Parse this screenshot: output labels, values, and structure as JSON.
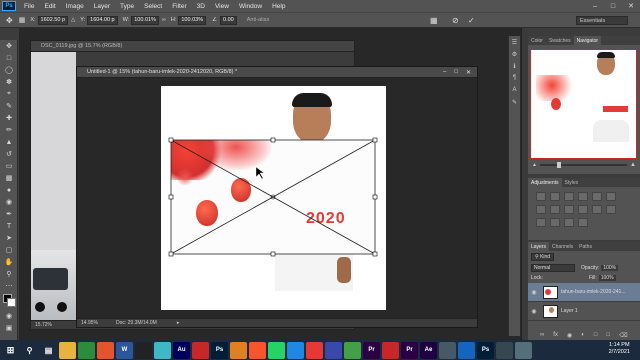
{
  "menubar": {
    "logo": "Ps",
    "items": [
      "File",
      "Edit",
      "Image",
      "Layer",
      "Type",
      "Select",
      "Filter",
      "3D",
      "View",
      "Window",
      "Help"
    ]
  },
  "options": {
    "x_label": "X:",
    "x_value": "1602.50 p",
    "y_label": "Y:",
    "y_value": "1604.00 p",
    "w_label": "W:",
    "w_value": "100.01%",
    "h_label": "H:",
    "h_value": "100.03%",
    "angle_value": "0.00",
    "antialias": "Anti-alias",
    "workspace": "Essentials"
  },
  "doc1": {
    "tab": "DSC_0119.jpg @ 15.7% (RGB/8)",
    "zoom": "15.72%"
  },
  "doc2": {
    "tab": "Untitled-1 @ 15% (tahun-baru-imlek-2020-2412020, RGB/8) *",
    "zoom": "14.95%",
    "doc_size": "Doc: 29.3M/14.0M",
    "banner_text": "2020"
  },
  "top_panel": {
    "tabs": [
      "Color",
      "Swatches",
      "Navigator"
    ],
    "active": "Navigator"
  },
  "adj_panel": {
    "tabs": [
      "Adjustments",
      "Styles"
    ]
  },
  "layers_panel": {
    "tabs": [
      "Layers",
      "Channels",
      "Paths"
    ],
    "kind": "Kind",
    "blend": "Normal",
    "opacity_label": "Opacity:",
    "opacity_value": "100%",
    "lock_label": "Lock:",
    "fill_label": "Fill:",
    "fill_value": "100%",
    "layers": [
      "tahun-baru-imlek-2020-241...",
      "Layer 1"
    ]
  },
  "taskbar": {
    "apps": [
      {
        "name": "start",
        "label": "",
        "color": "#1c2a3e"
      },
      {
        "name": "search",
        "label": "",
        "color": "#1c2a3e"
      },
      {
        "name": "taskview",
        "label": "",
        "color": "#1c2a3e"
      },
      {
        "name": "explorer",
        "label": "",
        "color": "#e8b33c"
      },
      {
        "name": "chrome",
        "label": "",
        "color": "#2d8c3c"
      },
      {
        "name": "firefox",
        "label": "",
        "color": "#e2562b"
      },
      {
        "name": "word",
        "label": "W",
        "color": "#2b579a"
      },
      {
        "name": "media",
        "label": "",
        "color": "#222222"
      },
      {
        "name": "filmora",
        "label": "",
        "color": "#3fb8c6"
      },
      {
        "name": "audition",
        "label": "Au",
        "color": "#00005b"
      },
      {
        "name": "media2",
        "label": "",
        "color": "#c62828"
      },
      {
        "name": "photoshop",
        "label": "Ps",
        "color": "#001e36"
      },
      {
        "name": "app-orange",
        "label": "",
        "color": "#e08020"
      },
      {
        "name": "brave",
        "label": "",
        "color": "#fb542b"
      },
      {
        "name": "whatsapp",
        "label": "",
        "color": "#25d366"
      },
      {
        "name": "app-c",
        "label": "",
        "color": "#1e88e5"
      },
      {
        "name": "app-music",
        "label": "",
        "color": "#e53935"
      },
      {
        "name": "app-s",
        "label": "",
        "color": "#3949ab"
      },
      {
        "name": "app-green",
        "label": "",
        "color": "#43a047"
      },
      {
        "name": "premiere",
        "label": "Pr",
        "color": "#2a0045"
      },
      {
        "name": "app-red",
        "label": "",
        "color": "#c62828"
      },
      {
        "name": "premiere2",
        "label": "Pr",
        "color": "#2a0045"
      },
      {
        "name": "aftereffects",
        "label": "Ae",
        "color": "#1f0040"
      },
      {
        "name": "app-blank",
        "label": "",
        "color": "#455a64"
      },
      {
        "name": "app-blue",
        "label": "",
        "color": "#1565c0"
      },
      {
        "name": "photoshop2",
        "label": "Ps",
        "color": "#001e36"
      },
      {
        "name": "app-x",
        "label": "",
        "color": "#37474f"
      },
      {
        "name": "app-y",
        "label": "",
        "color": "#546e7a"
      }
    ],
    "time": "1:14 PM",
    "date": "2/7/2021"
  }
}
